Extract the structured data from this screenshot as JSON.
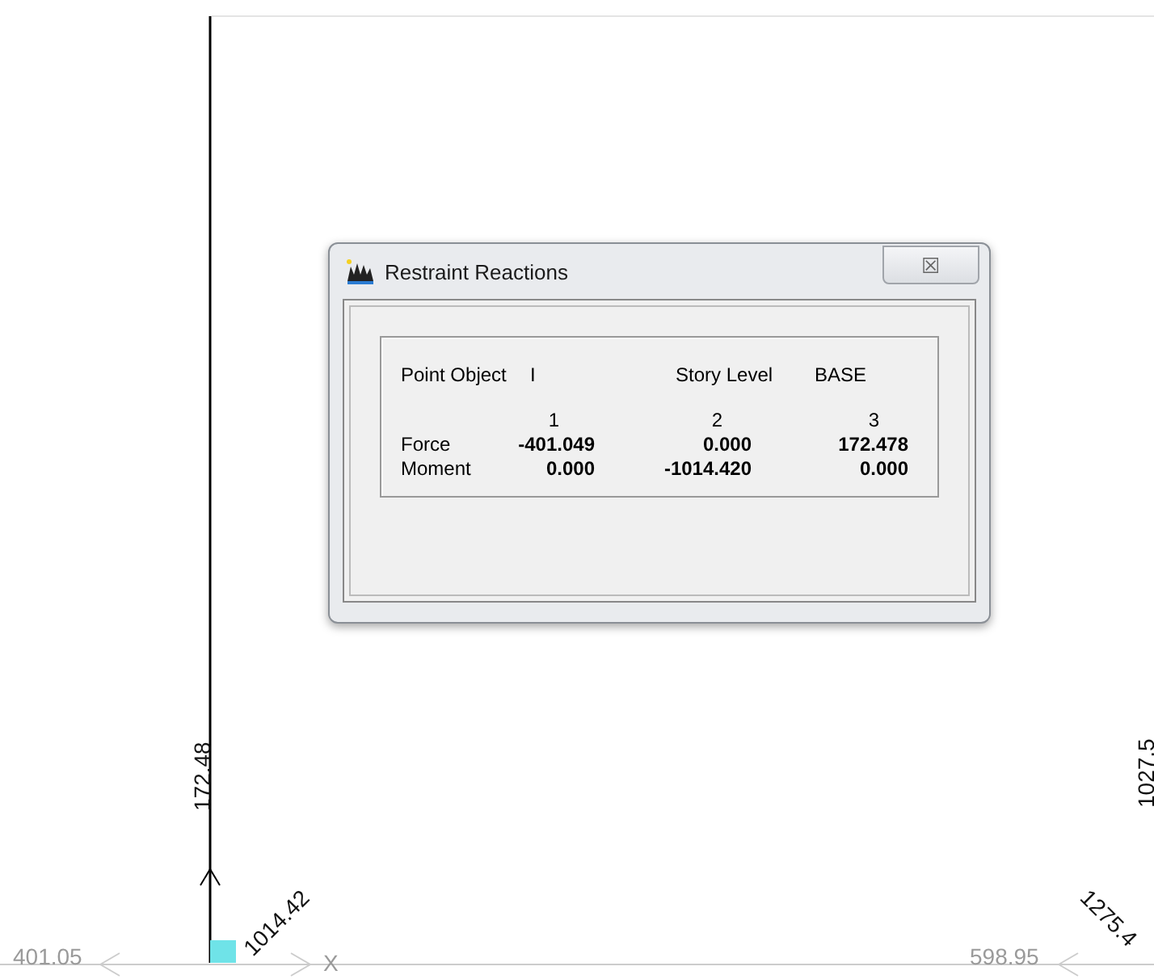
{
  "canvas": {
    "labels": [
      {
        "text": "172.48",
        "kind": "vertical"
      },
      {
        "text": "1014.42",
        "kind": "diagonal-up"
      },
      {
        "text": "401.05",
        "kind": "ground"
      },
      {
        "text": "X",
        "kind": "axis"
      },
      {
        "text": "598.95",
        "kind": "ground"
      },
      {
        "text": "1275.4",
        "kind": "diagonal-down"
      },
      {
        "text": "1027.5",
        "kind": "vertical"
      }
    ]
  },
  "dialog": {
    "title": "Restraint Reactions",
    "close": "☒",
    "point_object_label": "Point Object",
    "point_object": "I",
    "story_level_label": "Story Level",
    "story_level": "BASE",
    "columns": [
      "1",
      "2",
      "3"
    ],
    "rows": [
      {
        "label": "Force",
        "values": [
          "-401.049",
          "0.000",
          "172.478"
        ]
      },
      {
        "label": "Moment",
        "values": [
          "0.000",
          "-1014.420",
          "0.000"
        ]
      }
    ]
  }
}
